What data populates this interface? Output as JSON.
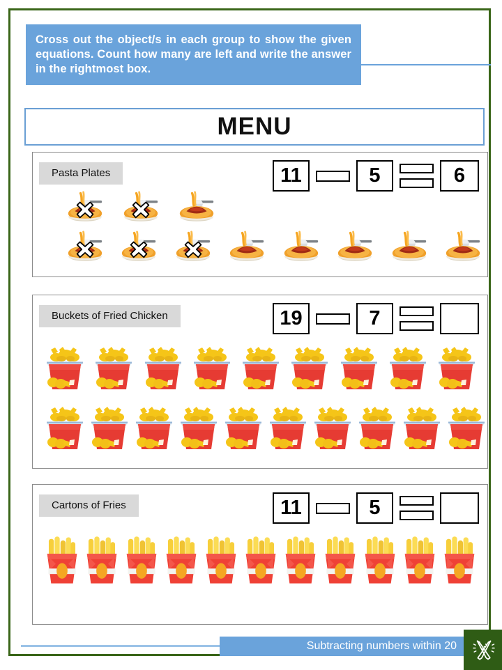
{
  "theme": {
    "border_color": "#3a6619",
    "accent_blue": "#6aa3db",
    "label_gray": "#d9d9d9",
    "logo_green": "#2f5c15"
  },
  "instruction": {
    "text": "Cross out the object/s in each group to show the given equations. Count how many are left and write the answer in the rightmost box."
  },
  "menu": {
    "title": "MENU"
  },
  "sections": [
    {
      "label": "Pasta Plates",
      "icon": "pasta-icon",
      "equation": {
        "minuend": "11",
        "operator": "minus",
        "subtrahend": "5",
        "equals": "equals",
        "answer": "6"
      },
      "rows": [
        {
          "count": 3,
          "crossed": [
            0,
            1
          ]
        },
        {
          "count": 8,
          "crossed": [
            0,
            1,
            2
          ]
        }
      ]
    },
    {
      "label": "Buckets of Fried Chicken",
      "icon": "chicken-bucket-icon",
      "equation": {
        "minuend": "19",
        "operator": "minus",
        "subtrahend": "7",
        "equals": "equals",
        "answer": ""
      },
      "rows": [
        {
          "count": 9,
          "crossed": []
        },
        {
          "count": 10,
          "crossed": []
        }
      ]
    },
    {
      "label": "Cartons of Fries",
      "icon": "fries-icon",
      "equation": {
        "minuend": "11",
        "operator": "minus",
        "subtrahend": "5",
        "equals": "equals",
        "answer": ""
      },
      "rows": [
        {
          "count": 11,
          "crossed": []
        }
      ]
    }
  ],
  "footer": {
    "caption": "Subtracting numbers within 20",
    "logo": "pencil-ruler-logo"
  }
}
